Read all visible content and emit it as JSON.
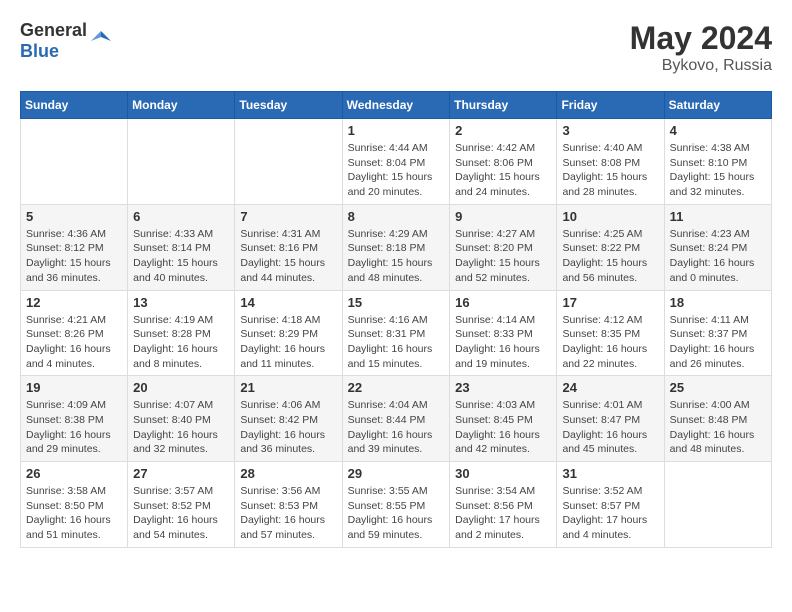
{
  "header": {
    "logo_general": "General",
    "logo_blue": "Blue",
    "month": "May 2024",
    "location": "Bykovo, Russia"
  },
  "weekdays": [
    "Sunday",
    "Monday",
    "Tuesday",
    "Wednesday",
    "Thursday",
    "Friday",
    "Saturday"
  ],
  "weeks": [
    [
      {
        "day": "",
        "sunrise": "",
        "sunset": "",
        "daylight": ""
      },
      {
        "day": "",
        "sunrise": "",
        "sunset": "",
        "daylight": ""
      },
      {
        "day": "",
        "sunrise": "",
        "sunset": "",
        "daylight": ""
      },
      {
        "day": "1",
        "sunrise": "Sunrise: 4:44 AM",
        "sunset": "Sunset: 8:04 PM",
        "daylight": "Daylight: 15 hours and 20 minutes."
      },
      {
        "day": "2",
        "sunrise": "Sunrise: 4:42 AM",
        "sunset": "Sunset: 8:06 PM",
        "daylight": "Daylight: 15 hours and 24 minutes."
      },
      {
        "day": "3",
        "sunrise": "Sunrise: 4:40 AM",
        "sunset": "Sunset: 8:08 PM",
        "daylight": "Daylight: 15 hours and 28 minutes."
      },
      {
        "day": "4",
        "sunrise": "Sunrise: 4:38 AM",
        "sunset": "Sunset: 8:10 PM",
        "daylight": "Daylight: 15 hours and 32 minutes."
      }
    ],
    [
      {
        "day": "5",
        "sunrise": "Sunrise: 4:36 AM",
        "sunset": "Sunset: 8:12 PM",
        "daylight": "Daylight: 15 hours and 36 minutes."
      },
      {
        "day": "6",
        "sunrise": "Sunrise: 4:33 AM",
        "sunset": "Sunset: 8:14 PM",
        "daylight": "Daylight: 15 hours and 40 minutes."
      },
      {
        "day": "7",
        "sunrise": "Sunrise: 4:31 AM",
        "sunset": "Sunset: 8:16 PM",
        "daylight": "Daylight: 15 hours and 44 minutes."
      },
      {
        "day": "8",
        "sunrise": "Sunrise: 4:29 AM",
        "sunset": "Sunset: 8:18 PM",
        "daylight": "Daylight: 15 hours and 48 minutes."
      },
      {
        "day": "9",
        "sunrise": "Sunrise: 4:27 AM",
        "sunset": "Sunset: 8:20 PM",
        "daylight": "Daylight: 15 hours and 52 minutes."
      },
      {
        "day": "10",
        "sunrise": "Sunrise: 4:25 AM",
        "sunset": "Sunset: 8:22 PM",
        "daylight": "Daylight: 15 hours and 56 minutes."
      },
      {
        "day": "11",
        "sunrise": "Sunrise: 4:23 AM",
        "sunset": "Sunset: 8:24 PM",
        "daylight": "Daylight: 16 hours and 0 minutes."
      }
    ],
    [
      {
        "day": "12",
        "sunrise": "Sunrise: 4:21 AM",
        "sunset": "Sunset: 8:26 PM",
        "daylight": "Daylight: 16 hours and 4 minutes."
      },
      {
        "day": "13",
        "sunrise": "Sunrise: 4:19 AM",
        "sunset": "Sunset: 8:28 PM",
        "daylight": "Daylight: 16 hours and 8 minutes."
      },
      {
        "day": "14",
        "sunrise": "Sunrise: 4:18 AM",
        "sunset": "Sunset: 8:29 PM",
        "daylight": "Daylight: 16 hours and 11 minutes."
      },
      {
        "day": "15",
        "sunrise": "Sunrise: 4:16 AM",
        "sunset": "Sunset: 8:31 PM",
        "daylight": "Daylight: 16 hours and 15 minutes."
      },
      {
        "day": "16",
        "sunrise": "Sunrise: 4:14 AM",
        "sunset": "Sunset: 8:33 PM",
        "daylight": "Daylight: 16 hours and 19 minutes."
      },
      {
        "day": "17",
        "sunrise": "Sunrise: 4:12 AM",
        "sunset": "Sunset: 8:35 PM",
        "daylight": "Daylight: 16 hours and 22 minutes."
      },
      {
        "day": "18",
        "sunrise": "Sunrise: 4:11 AM",
        "sunset": "Sunset: 8:37 PM",
        "daylight": "Daylight: 16 hours and 26 minutes."
      }
    ],
    [
      {
        "day": "19",
        "sunrise": "Sunrise: 4:09 AM",
        "sunset": "Sunset: 8:38 PM",
        "daylight": "Daylight: 16 hours and 29 minutes."
      },
      {
        "day": "20",
        "sunrise": "Sunrise: 4:07 AM",
        "sunset": "Sunset: 8:40 PM",
        "daylight": "Daylight: 16 hours and 32 minutes."
      },
      {
        "day": "21",
        "sunrise": "Sunrise: 4:06 AM",
        "sunset": "Sunset: 8:42 PM",
        "daylight": "Daylight: 16 hours and 36 minutes."
      },
      {
        "day": "22",
        "sunrise": "Sunrise: 4:04 AM",
        "sunset": "Sunset: 8:44 PM",
        "daylight": "Daylight: 16 hours and 39 minutes."
      },
      {
        "day": "23",
        "sunrise": "Sunrise: 4:03 AM",
        "sunset": "Sunset: 8:45 PM",
        "daylight": "Daylight: 16 hours and 42 minutes."
      },
      {
        "day": "24",
        "sunrise": "Sunrise: 4:01 AM",
        "sunset": "Sunset: 8:47 PM",
        "daylight": "Daylight: 16 hours and 45 minutes."
      },
      {
        "day": "25",
        "sunrise": "Sunrise: 4:00 AM",
        "sunset": "Sunset: 8:48 PM",
        "daylight": "Daylight: 16 hours and 48 minutes."
      }
    ],
    [
      {
        "day": "26",
        "sunrise": "Sunrise: 3:58 AM",
        "sunset": "Sunset: 8:50 PM",
        "daylight": "Daylight: 16 hours and 51 minutes."
      },
      {
        "day": "27",
        "sunrise": "Sunrise: 3:57 AM",
        "sunset": "Sunset: 8:52 PM",
        "daylight": "Daylight: 16 hours and 54 minutes."
      },
      {
        "day": "28",
        "sunrise": "Sunrise: 3:56 AM",
        "sunset": "Sunset: 8:53 PM",
        "daylight": "Daylight: 16 hours and 57 minutes."
      },
      {
        "day": "29",
        "sunrise": "Sunrise: 3:55 AM",
        "sunset": "Sunset: 8:55 PM",
        "daylight": "Daylight: 16 hours and 59 minutes."
      },
      {
        "day": "30",
        "sunrise": "Sunrise: 3:54 AM",
        "sunset": "Sunset: 8:56 PM",
        "daylight": "Daylight: 17 hours and 2 minutes."
      },
      {
        "day": "31",
        "sunrise": "Sunrise: 3:52 AM",
        "sunset": "Sunset: 8:57 PM",
        "daylight": "Daylight: 17 hours and 4 minutes."
      },
      {
        "day": "",
        "sunrise": "",
        "sunset": "",
        "daylight": ""
      }
    ]
  ]
}
